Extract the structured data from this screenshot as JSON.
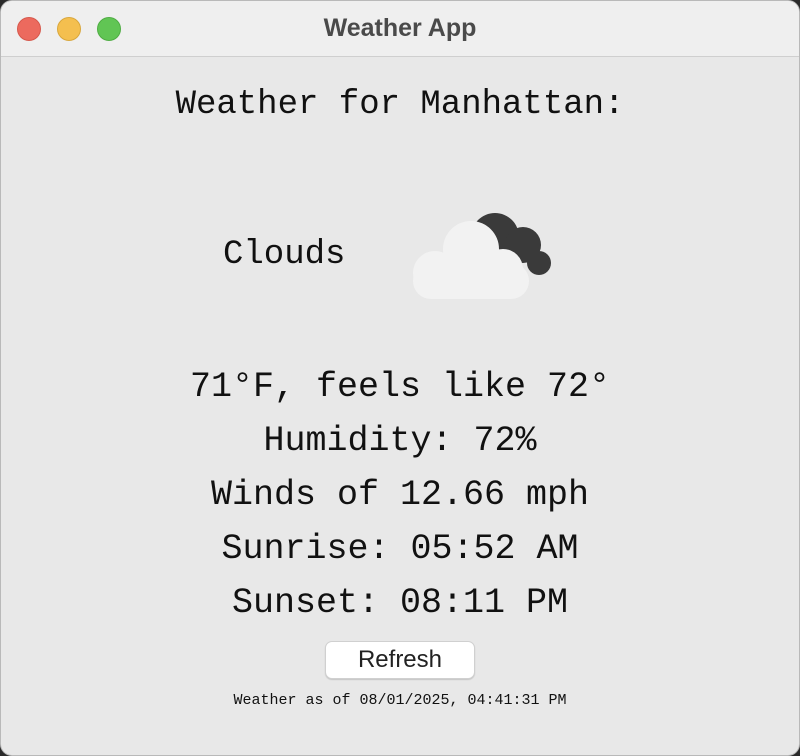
{
  "window": {
    "title": "Weather App"
  },
  "weather": {
    "heading": "Weather for Manhattan:",
    "condition": "Clouds",
    "condition_icon": "clouds-icon",
    "temperature_line": "71°F, feels like 72°",
    "humidity_line": "Humidity: 72%",
    "wind_line": "Winds of 12.66 mph",
    "sunrise_line": "Sunrise: 05:52 AM",
    "sunset_line": "Sunset: 08:11 PM"
  },
  "actions": {
    "refresh_label": "Refresh"
  },
  "footer": {
    "timestamp": "Weather as of 08/01/2025, 04:41:31 PM"
  },
  "colors": {
    "window_bg": "#e8e8e8",
    "close": "#ec6a5e",
    "minimize": "#f4bf4f",
    "zoom": "#61c554",
    "light_cloud": "#f2f2f2",
    "dark_cloud": "#3a3a3a"
  }
}
